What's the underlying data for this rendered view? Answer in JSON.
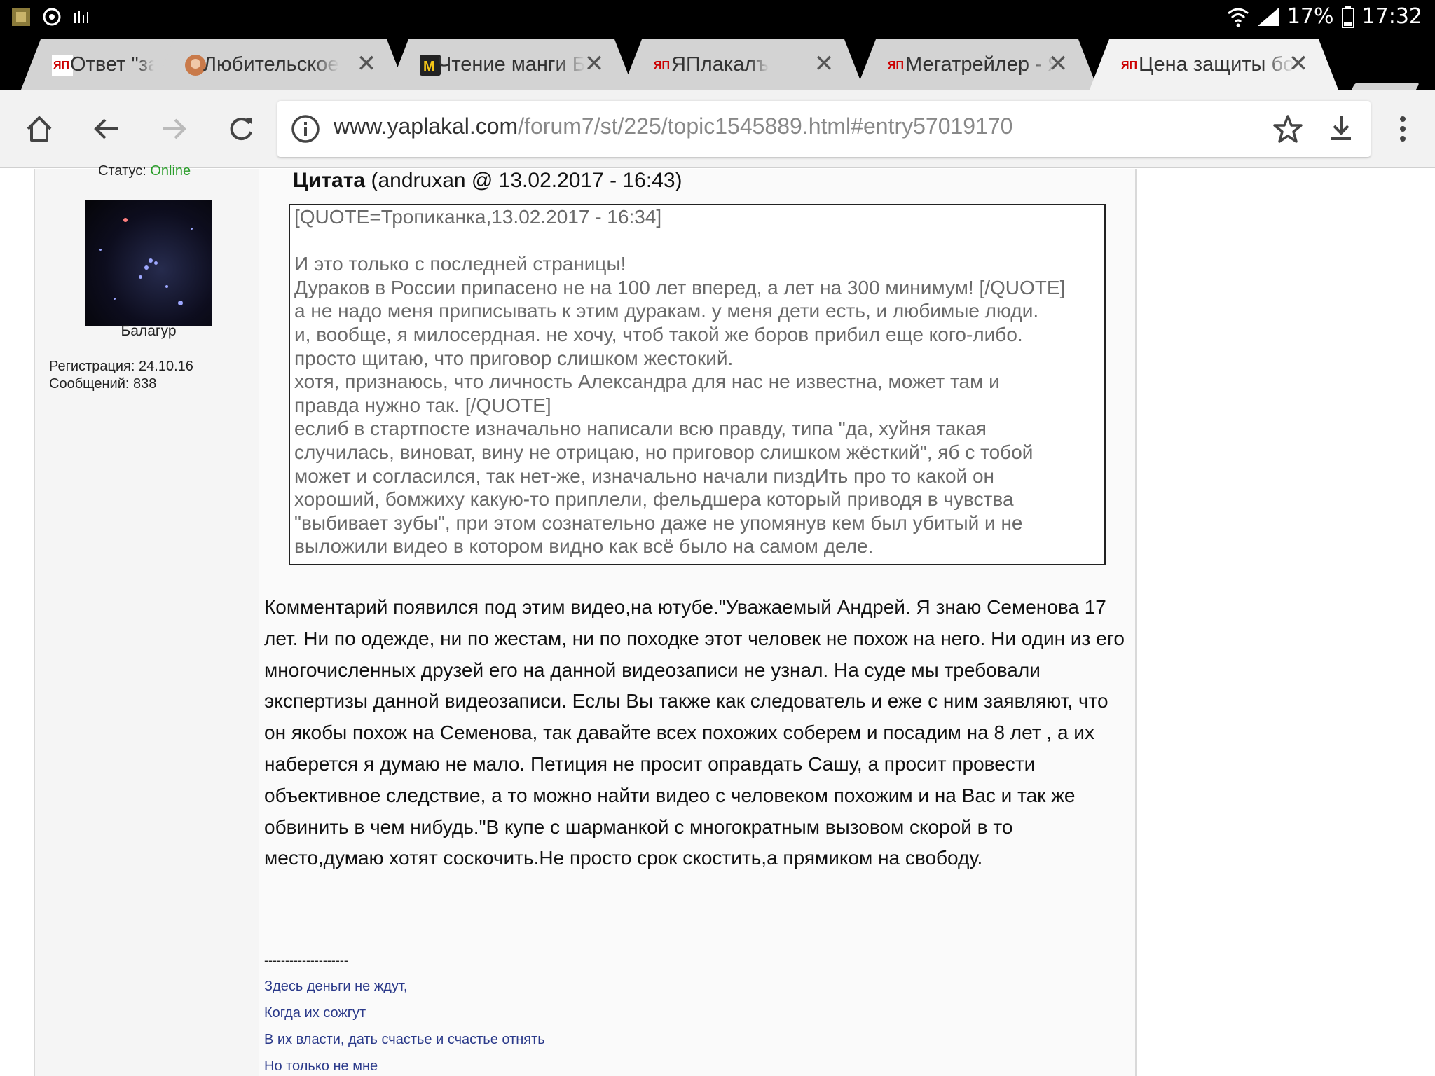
{
  "status_bar": {
    "battery": "17%",
    "time": "17:32"
  },
  "tabs": [
    {
      "title": "Ответ \"зак",
      "favicon": "yaplakal-icon"
    },
    {
      "title": "Любительское",
      "favicon": "avatar-icon"
    },
    {
      "title": "Чтение манги Б",
      "favicon": "manga-icon"
    },
    {
      "title": "ЯПлакалъ",
      "favicon": "yaplakal-icon"
    },
    {
      "title": "Мегатрейлер - Я",
      "favicon": "yaplakal-icon"
    },
    {
      "title": "Цена защиты бо",
      "favicon": "yaplakal-icon"
    }
  ],
  "close_glyph": "✕",
  "omnibox": {
    "host": "www.yaplakal.com",
    "path": "/forum7/st/225/topic1545889.html#entry57019170"
  },
  "user": {
    "status_label": "Статус:",
    "status_value": "Online",
    "name": "Балагур",
    "registration": "Регистрация: 24.10.16",
    "messages": "Сообщений: 838"
  },
  "quote": {
    "label": "Цитата",
    "meta": "(andruxan @ 13.02.2017 - 16:43)",
    "text": "[QUOTE=Тропиканка,13.02.2017 - 16:34]\n\nИ это только с последней страницы!\nДураков в России припасено не на 100 лет вперед, а лет на 300 минимум! [/QUOTE]\nа не надо меня приписывать к этим дуракам. у меня дети есть, и любимые люди.\nи, вообще, я милосердная. не хочу, чтоб такой же боров прибил еще кого-либо.\nпросто щитаю, что приговор слишком жестокий.\nхотя, признаюсь, что личность Александра для нас не известна, может там и\nправда нужно так. [/QUOTE]\nеслиб в стартпосте изначально написали всю правду, типа \"да, хуйня такая\nслучилась, виноват, вину не отрицаю, но приговор слишком жёсткий\", яб с тобой\nможет и согласился, так нет-же, изначально начали пиздИть про то какой он\nхороший, бомжиху какую-то приплели, фельдшера который приводя в чувства\n\"выбивает зубы\", при этом сознательно даже не упомянув кем был убитый и не\nвыложили видео в котором видно как всё было на самом деле."
  },
  "post": {
    "body": "Комментарий появился под этим видео,на ютубе.\"Уважаемый Андрей. Я знаю Семенова 17 лет. Ни по одежде, ни по жестам, ни по походке этот человек не похож на него. Ни один из его многочисленных друзей его на данной видеозаписи не узнал. На суде мы требовали экспертизы данной видеозаписи. Еслы Вы также как следователь и еже с ним заявляют, что он якобы похож на Семенова, так давайте всех похожих соберем и посадим на 8 лет , а их наберется я думаю не мало. Петиция не просит оправдать Сашу, а просит провести объективное следствие, а то можно найти видео с человеком похожим и на Вас и так же обвинить в чем нибудь.\"В купе с шарманкой с многократным вызовом скорой в то место,думаю хотят соскочить.Не просто срок скостить,а прямиком на свободу."
  },
  "signature": {
    "separator": "--------------------",
    "lines": [
      "Здесь деньги не ждут,",
      "Когда их сожгут",
      "В их власти, дать счастье и счастье отнять",
      "Но только не мне"
    ]
  },
  "colors": {
    "online": "#2a9d2a",
    "signature": "#2b3a8a",
    "quote_text": "#6a6a6a"
  }
}
